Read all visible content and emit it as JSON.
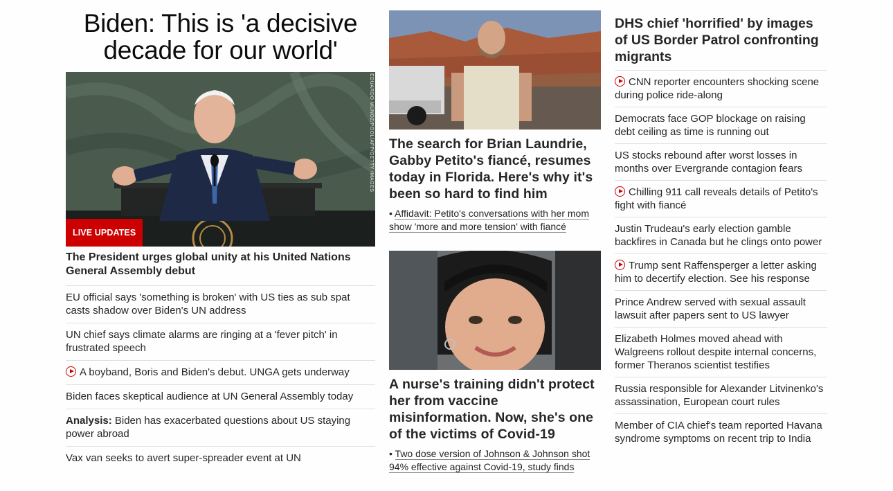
{
  "left": {
    "headline": "Biden: This is 'a decisive decade for our world'",
    "hero": {
      "photo_credit": "EDUARDO MUNOZ/POOL/AFP/GETTY IMAGES",
      "badge": "LIVE UPDATES"
    },
    "sub_headline": "The President urges global unity at his United Nations General Assembly debut",
    "links": [
      {
        "text": "EU official says 'something is broken' with US ties as sub spat casts shadow over Biden's UN address",
        "video": false
      },
      {
        "text": "UN chief says climate alarms are ringing at a 'fever pitch' in frustrated speech",
        "video": false
      },
      {
        "text": "A boyband, Boris and Biden's debut. UNGA gets underway",
        "video": true
      },
      {
        "text": "Biden faces skeptical audience at UN General Assembly today",
        "video": false
      },
      {
        "prefix": "Analysis:",
        "text": " Biden has exacerbated questions about US staying power abroad",
        "video": false
      },
      {
        "text": "Vax van seeks to avert super-spreader event at UN",
        "video": false
      }
    ]
  },
  "middle": {
    "story1": {
      "headline": "The search for Brian Laundrie, Gabby Petito's fiancé, resumes today in Florida. Here's why it's been so hard to find him",
      "related": "Affidavit: Petito's conversations with her mom show 'more and more tension' with fiancé"
    },
    "story2": {
      "headline": "A nurse's training didn't protect her from vaccine misinformation. Now, she's one of the victims of Covid-19",
      "related": "Two dose version of Johnson & Johnson shot 94% effective against Covid-19, study finds"
    }
  },
  "right": {
    "headline": "DHS chief 'horrified' by images of US Border Patrol confronting migrants",
    "links": [
      {
        "text": "CNN reporter encounters shocking scene during police ride-along",
        "video": true
      },
      {
        "text": "Democrats face GOP blockage on raising debt ceiling as time is running out",
        "video": false
      },
      {
        "text": "US stocks rebound after worst losses in months over Evergrande contagion fears",
        "video": false
      },
      {
        "text": "Chilling 911 call reveals details of Petito's fight with fiancé",
        "video": true
      },
      {
        "text": "Justin Trudeau's early election gamble backfires in Canada but he clings onto power",
        "video": false
      },
      {
        "text": "Trump sent Raffensperger a letter asking him to decertify election. See his response",
        "video": true
      },
      {
        "text": "Prince Andrew served with sexual assault lawsuit after papers sent to US lawyer",
        "video": false
      },
      {
        "text": "Elizabeth Holmes moved ahead with Walgreens rollout despite internal concerns, former Theranos scientist testifies",
        "video": false
      },
      {
        "text": "Russia responsible for Alexander Litvinenko's assassination, European court rules",
        "video": false
      },
      {
        "text": "Member of CIA chief's team reported Havana syndrome symptoms on recent trip to India",
        "video": false
      }
    ]
  },
  "colors": {
    "accent_red": "#cc0000",
    "text": "#262626",
    "divider": "#e0e0e0"
  }
}
